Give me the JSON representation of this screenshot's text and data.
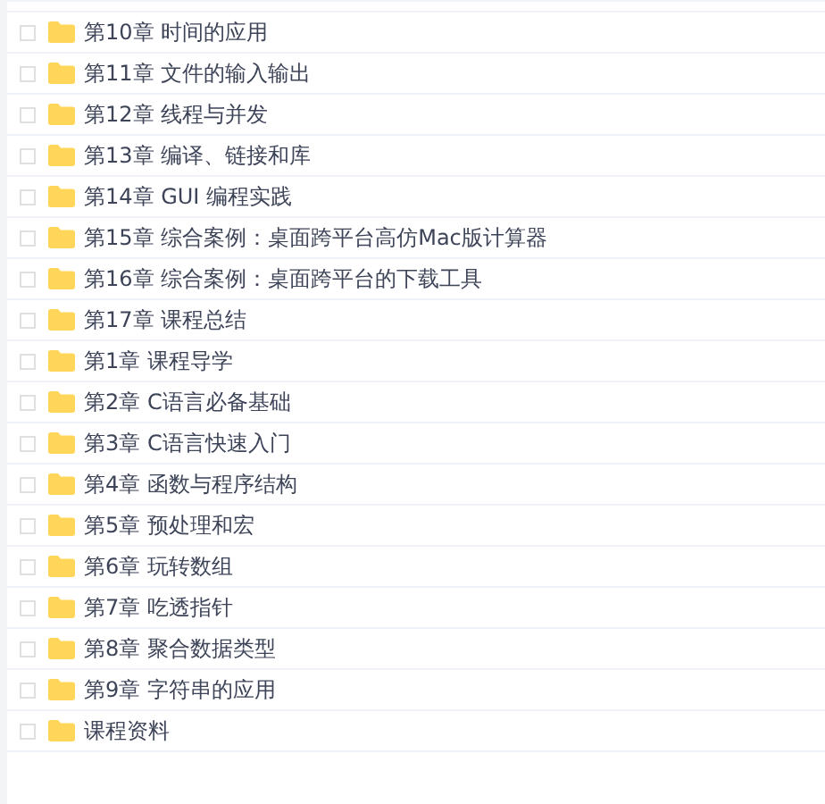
{
  "files": [
    {
      "name": "第10章 时间的应用",
      "checked": false
    },
    {
      "name": "第11章 文件的输入输出",
      "checked": false
    },
    {
      "name": "第12章 线程与并发",
      "checked": false
    },
    {
      "name": "第13章 编译、链接和库",
      "checked": false
    },
    {
      "name": "第14章 GUI 编程实践",
      "checked": false
    },
    {
      "name": "第15章 综合案例：桌面跨平台高仿Mac版计算器",
      "checked": false
    },
    {
      "name": "第16章 综合案例：桌面跨平台的下载工具",
      "checked": false
    },
    {
      "name": "第17章 课程总结",
      "checked": false
    },
    {
      "name": "第1章 课程导学",
      "checked": false
    },
    {
      "name": "第2章 C语言必备基础",
      "checked": false
    },
    {
      "name": "第3章 C语言快速入门",
      "checked": false
    },
    {
      "name": "第4章 函数与程序结构",
      "checked": false
    },
    {
      "name": "第5章 预处理和宏",
      "checked": false
    },
    {
      "name": "第6章 玩转数组",
      "checked": false
    },
    {
      "name": "第7章 吃透指针",
      "checked": false
    },
    {
      "name": "第8章 聚合数据类型",
      "checked": false
    },
    {
      "name": "第9章 字符串的应用",
      "checked": false
    },
    {
      "name": "课程资料",
      "checked": false
    }
  ]
}
